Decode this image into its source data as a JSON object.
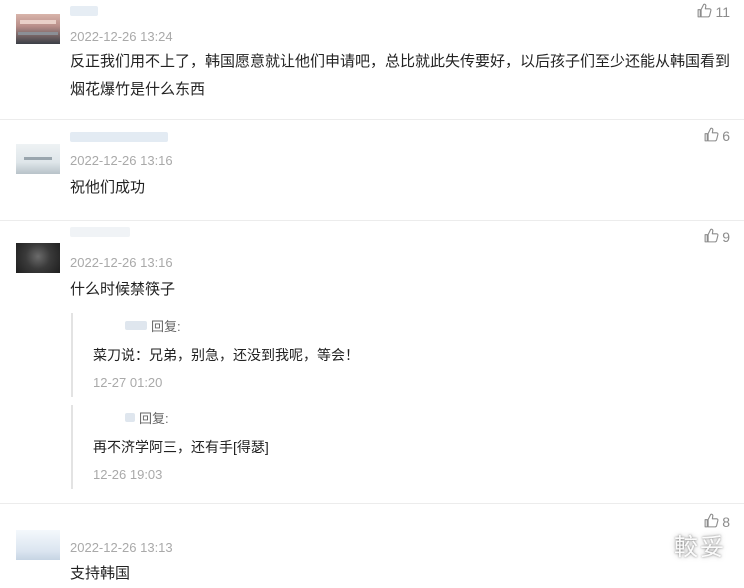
{
  "comments": [
    {
      "time": "2022-12-26 13:24",
      "text": "反正我们用不上了，韩国愿意就让他们申请吧，总比就此失传要好，以后孩子们至少还能从韩国看到烟花爆竹是什么东西",
      "likes": "11",
      "avatar_colors": [
        "#c9a7a0",
        "#3a3f46"
      ]
    },
    {
      "time": "2022-12-26 13:16",
      "text": "祝他们成功",
      "likes": "6",
      "avatar_colors": [
        "#dfe6ea",
        "#a8b3bb"
      ]
    },
    {
      "time": "2022-12-26 13:16",
      "text": "什么时候禁筷子",
      "likes": "9",
      "avatar_colors": [
        "#2b2b2b",
        "#6a6a6a"
      ],
      "replies": [
        {
          "head": "回复:",
          "text": "菜刀说：兄弟，别急，还没到我呢，等会！",
          "time": "12-27 01:20"
        },
        {
          "head": "回复:",
          "text": "再不济学阿三，还有手[得瑟]",
          "time": "12-26 19:03"
        }
      ]
    },
    {
      "time": "2022-12-26 13:13",
      "text": "支持韩国",
      "likes": "8",
      "avatar_colors": [
        "#e8eff7",
        "#c6d4e3"
      ]
    }
  ],
  "watermark": "較妥",
  "colors": {
    "meta": "#a9a9a9",
    "text": "#222222",
    "separator": "#ececec",
    "like": "#8c8c8c"
  },
  "icons": {
    "like": "thumbs-up-icon"
  }
}
